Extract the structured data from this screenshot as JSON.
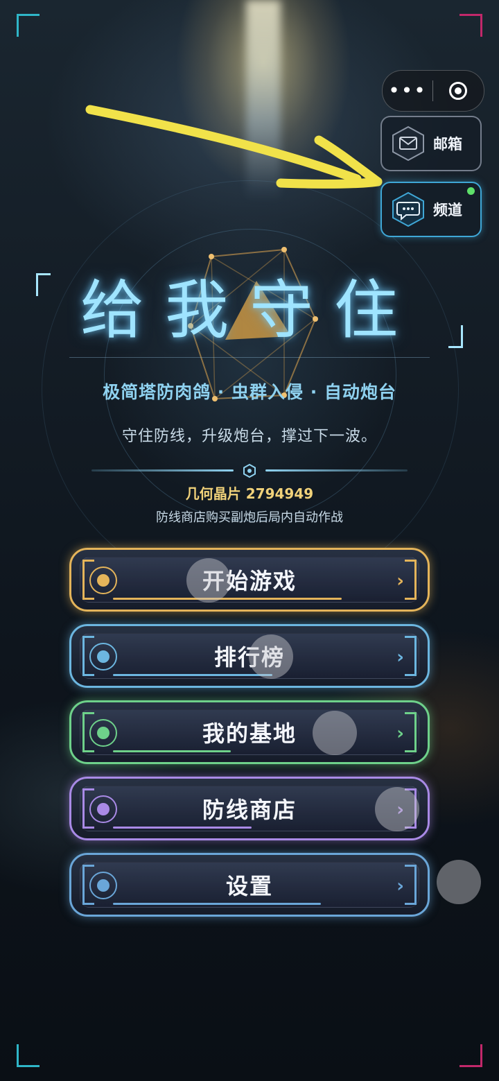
{
  "capsule": {
    "more_label": "•••"
  },
  "side_buttons": {
    "mail": {
      "label": "邮箱"
    },
    "channel": {
      "label": "频道"
    }
  },
  "title": "给我守住",
  "subtitle": "极简塔防肉鸽 · 虫群入侵 · 自动炮台",
  "tagline": "守住防线，升级炮台，撑过下一波。",
  "crystal": {
    "label": "几何晶片",
    "value": "2794949"
  },
  "hint": "防线商店购买副炮后局内自动作战",
  "menu": [
    {
      "label": "开始游戏",
      "color": "#e4b45a"
    },
    {
      "label": "排行榜",
      "color": "#6cb6e0"
    },
    {
      "label": "我的基地",
      "color": "#6ed18a"
    },
    {
      "label": "防线商店",
      "color": "#a98ae6"
    },
    {
      "label": "设置",
      "color": "#6aa6d8"
    }
  ],
  "chevron": "›",
  "colors": {
    "accent": "#8fd2f0",
    "gold": "#f1d27a",
    "arrow": "#f1e24a",
    "notify": "#5ee06a"
  }
}
